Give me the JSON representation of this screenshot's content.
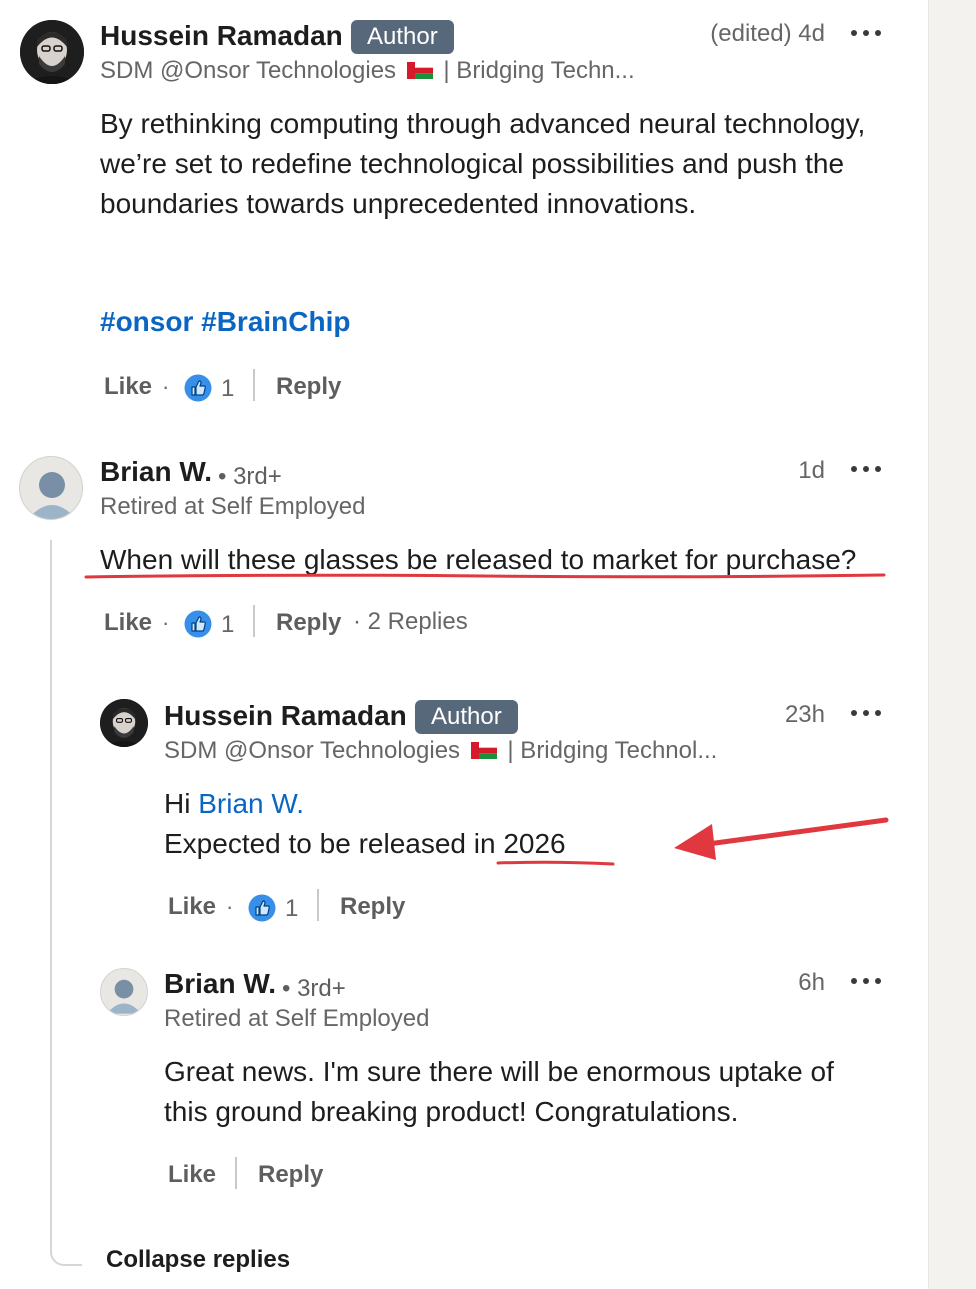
{
  "post": {
    "author": "Hussein Ramadan",
    "badge": "Author",
    "headline_pre": "SDM @Onsor Technologies",
    "headline_post": "| Bridging Techn...",
    "timestamp": "(edited)  4d",
    "body": "By rethinking computing through advanced neural technology, we’re set to redefine technological possibilities and push the boundaries towards unprecedented innovations.",
    "hashtags": "#onsor #BrainChip",
    "like_label": "Like",
    "like_count": "1",
    "reply_label": "Reply"
  },
  "comment": {
    "author": "Brian W.",
    "degree": "• 3rd+",
    "headline": "Retired at Self Employed",
    "timestamp": "1d",
    "body": "When will these glasses be released to market for purchase?",
    "like_label": "Like",
    "like_count": "1",
    "reply_label": "Reply",
    "replies_label": "· 2 Replies"
  },
  "reply1": {
    "author": "Hussein Ramadan",
    "badge": "Author",
    "headline_pre": "SDM @Onsor Technologies",
    "headline_post": "| Bridging Technol...",
    "timestamp": "23h",
    "greeting": "Hi ",
    "mention": "Brian W.",
    "body_pre": "Expected to be released in ",
    "body_year": "2026",
    "like_label": "Like",
    "like_count": "1",
    "reply_label": "Reply"
  },
  "reply2": {
    "author": "Brian W.",
    "degree": "• 3rd+",
    "headline": "Retired at Self Employed",
    "timestamp": "6h",
    "body": "Great news. I'm sure there will be enormous uptake of this ground breaking product! Congratulations.",
    "like_label": "Like",
    "reply_label": "Reply"
  },
  "collapse_label": "Collapse replies",
  "colors": {
    "accent": "#0a66c2",
    "badge_bg": "#56687a",
    "annotation_red": "#e0383e"
  },
  "icons": {
    "like": "thumbs-up-icon",
    "more": "more-horizontal-icon",
    "flag": "oman-flag-icon"
  }
}
